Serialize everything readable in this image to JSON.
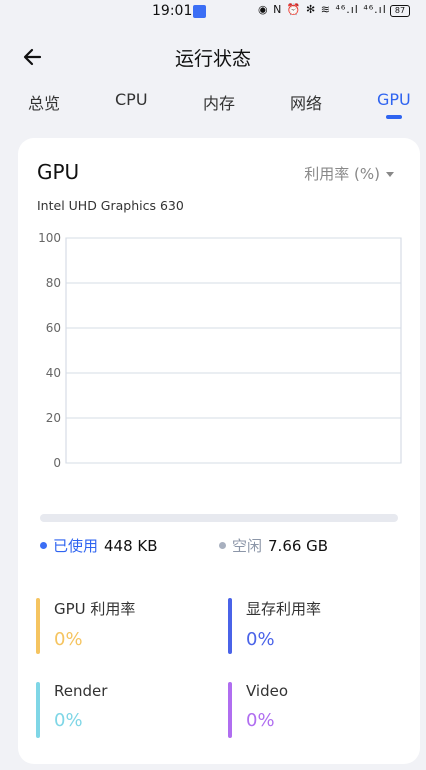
{
  "status_bar": {
    "time": "19:01",
    "icons": "◉ N ⏰ ✻ ≋ ⁴⁶.ıl ⁴⁶.ıl",
    "battery": "87"
  },
  "header": {
    "title": "运行状态"
  },
  "tabs": [
    {
      "label": "总览",
      "active": false
    },
    {
      "label": "CPU",
      "active": false
    },
    {
      "label": "内存",
      "active": false
    },
    {
      "label": "网络",
      "active": false
    },
    {
      "label": "GPU",
      "active": true
    }
  ],
  "card": {
    "title": "GPU",
    "metric_select": "利用率 (%)",
    "gpu_name": "Intel UHD Graphics 630"
  },
  "chart_data": {
    "type": "line",
    "title": "",
    "xlabel": "",
    "ylabel": "",
    "ylim": [
      0,
      100
    ],
    "y_ticks": [
      "100",
      "80",
      "60",
      "40",
      "20",
      "0"
    ],
    "series": [],
    "grid": true
  },
  "memory": {
    "used_label": "已使用",
    "used_value": "448 KB",
    "free_label": "空闲",
    "free_value": "7.66 GB",
    "used_fraction": 0.0001
  },
  "stats": [
    {
      "label": "GPU 利用率",
      "value": "0%",
      "color": "#f5c460"
    },
    {
      "label": "显存利用率",
      "value": "0%",
      "color": "#4a63e8"
    },
    {
      "label": "Render",
      "value": "0%",
      "color": "#7fd6e6"
    },
    {
      "label": "Video",
      "value": "0%",
      "color": "#b06ef0"
    }
  ],
  "colors": {
    "accent": "#2f64f0",
    "background": "#f1f2f6",
    "card": "#ffffff"
  }
}
